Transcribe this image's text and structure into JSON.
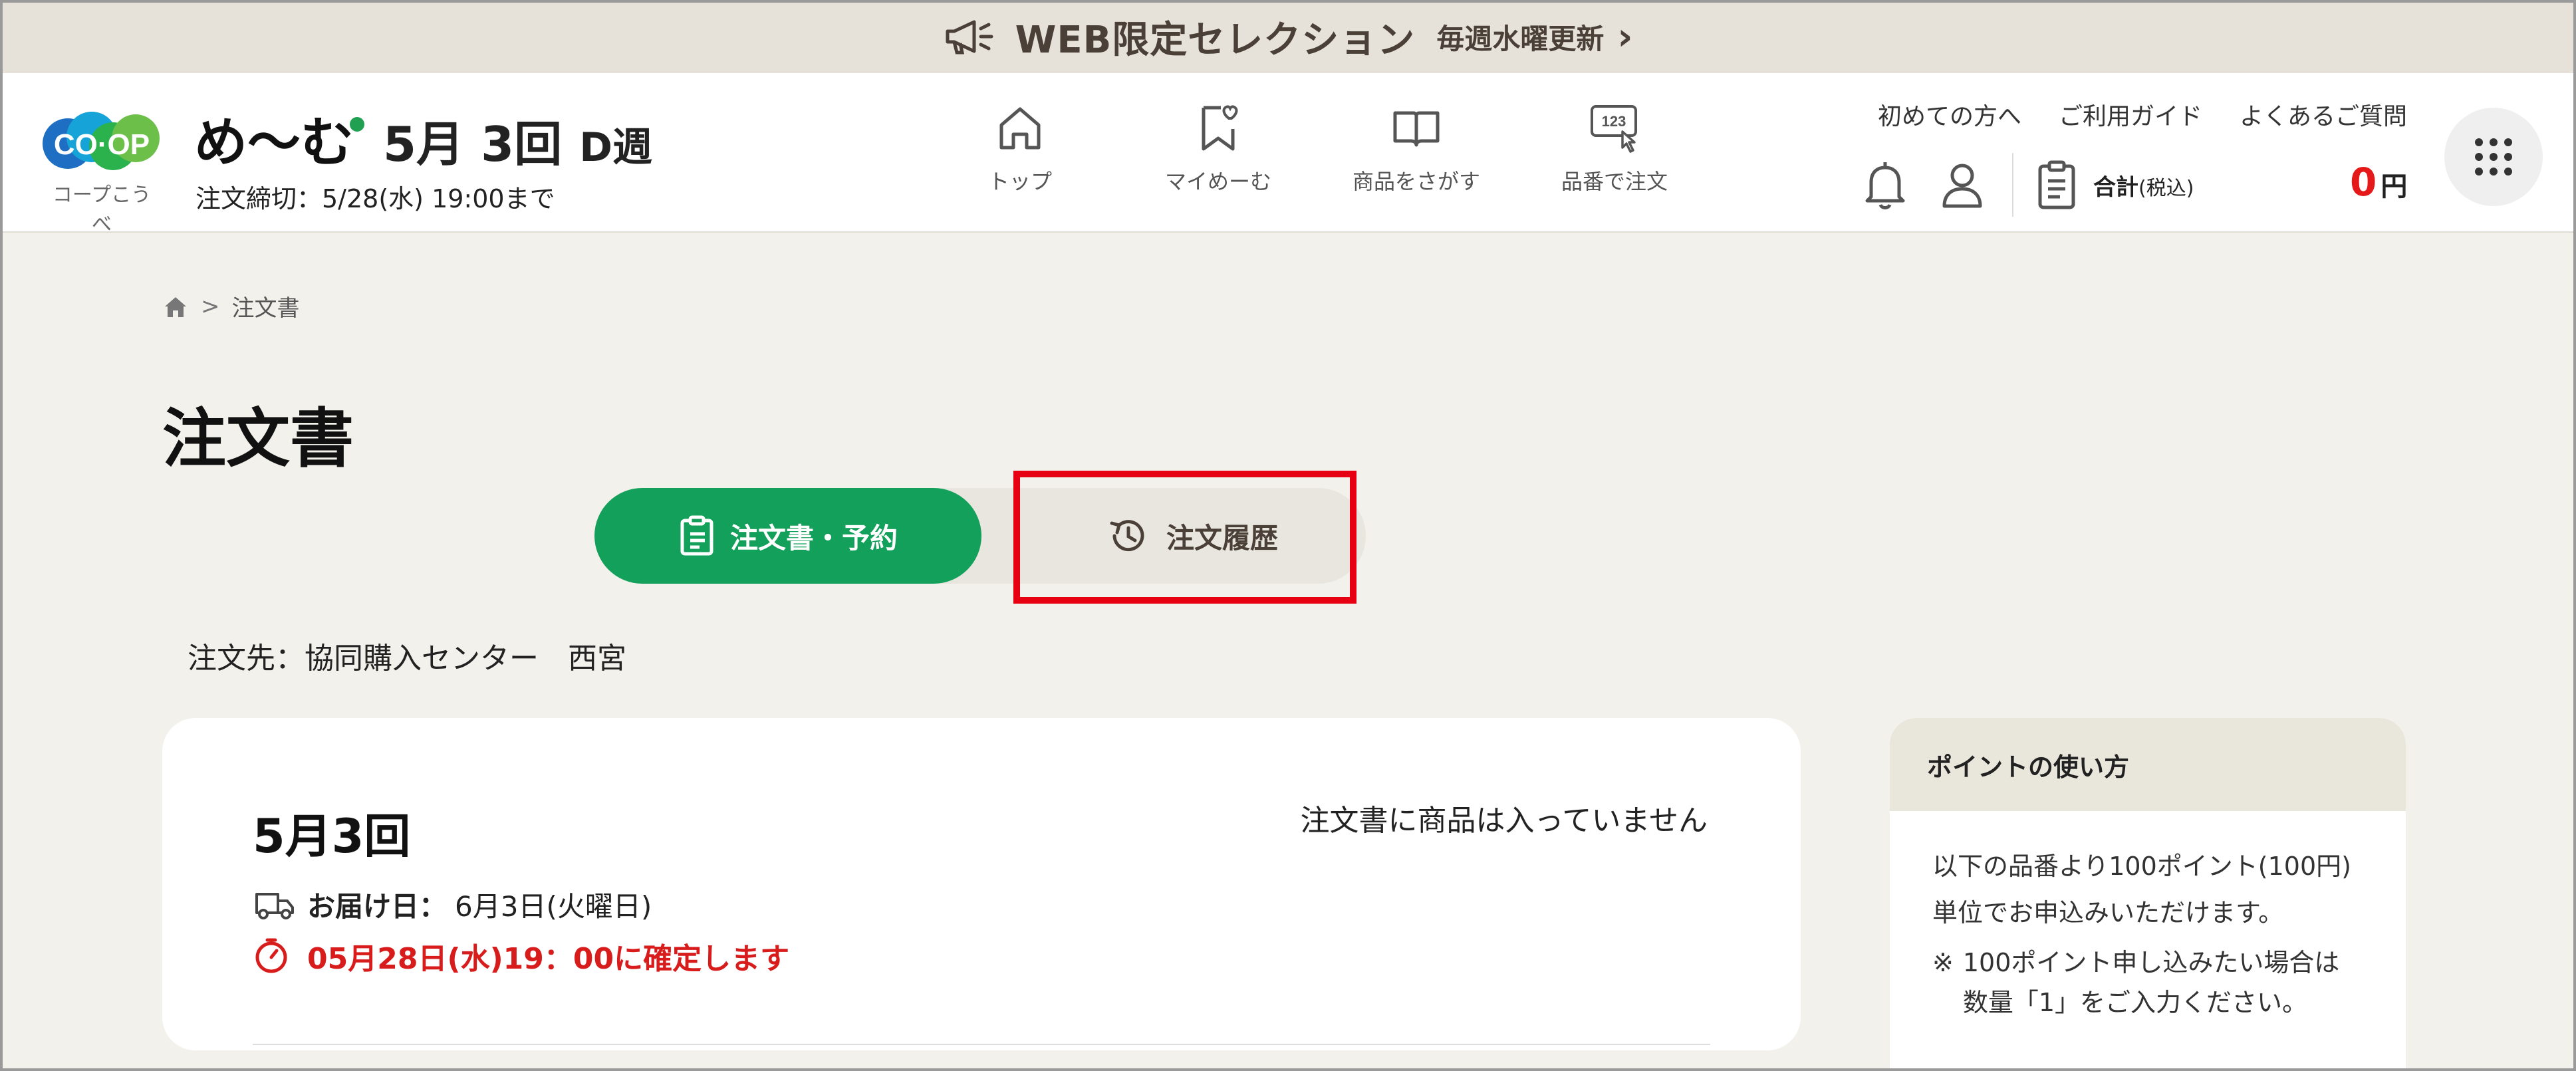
{
  "promo": {
    "icon": "megaphone-icon",
    "title": "WEB限定セレクション",
    "subtitle": "毎週水曜更新",
    "chevron": "›"
  },
  "header": {
    "logo_text": "CO·OP",
    "logo_sub": "コープこうべ",
    "brand": "め〜む",
    "round": "5月 3回",
    "week": "D週",
    "deadline": "注文締切：5/28(水) 19:00まで",
    "nav": [
      {
        "label": "トップ",
        "icon": "home-icon"
      },
      {
        "label": "マイめーむ",
        "icon": "bookmark-heart-icon"
      },
      {
        "label": "商品をさがす",
        "icon": "book-icon"
      },
      {
        "label": "品番で注文",
        "icon": "number-tap-icon"
      }
    ],
    "nav_icon_number": "123",
    "links": [
      "初めての方へ",
      "ご利用ガイド",
      "よくあるご質問"
    ],
    "total_label": "合計",
    "total_tax": "(税込)",
    "total_value": "0",
    "total_unit": "円",
    "accent_color": "#e51919"
  },
  "breadcrumb": {
    "current": "注文書"
  },
  "page": {
    "title": "注文書",
    "tabs": {
      "active": "注文書・予約",
      "history": "注文履歴"
    },
    "destination": "注文先：協同購入センター　西宮"
  },
  "order_card": {
    "round_title": "5月3回",
    "empty_message": "注文書に商品は入っていません",
    "delivery_label": "お届け日：",
    "delivery_value": "6月3日(火曜日)",
    "confirm_message": "05月28日(水)19：00に確定します"
  },
  "points": {
    "heading": "ポイントの使い方",
    "body": "以下の品番より100ポイント(100円)単位でお申込みいただけます。",
    "note_mark": "※",
    "note": "100ポイント申し込みたい場合は数量「1」をご入力ください。"
  },
  "colors": {
    "green": "#13a05a",
    "highlight": "#e60012"
  }
}
